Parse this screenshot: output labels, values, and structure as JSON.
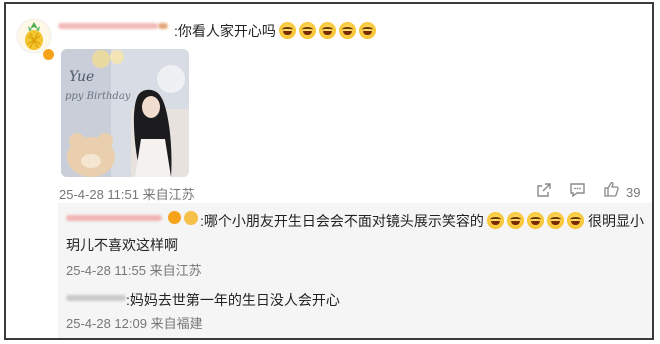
{
  "comment": {
    "text": ":你看人家开心吗",
    "emoji_count": 5,
    "photo": {
      "watermark_name": "Yue",
      "banner_text": "ppy Birthday"
    },
    "timestamp": "25-4-28 11:51 来自江苏",
    "likes": "39"
  },
  "replies": [
    {
      "text_before_emoji": ":哪个小朋友开生日会会不面对镜头展示笑容的",
      "emoji_count": 5,
      "text_after_emoji": "很明显小",
      "text_line2": "玥儿不喜欢这样啊",
      "timestamp": "25-4-28 11:55 来自江苏"
    },
    {
      "text": ":妈妈去世第一年的生日没人会开心",
      "timestamp": "25-4-28 12:09 来自福建"
    }
  ],
  "colors": {
    "frame": "#3a3a3a",
    "reply_bg": "#f5f5f5",
    "meta_text": "#777777",
    "verify_badge": "#f6a21b"
  },
  "icons": [
    "pineapple-avatar-icon",
    "verified-badge-icon",
    "share-icon",
    "comment-icon",
    "like-icon",
    "laughing-emoji-icon"
  ]
}
